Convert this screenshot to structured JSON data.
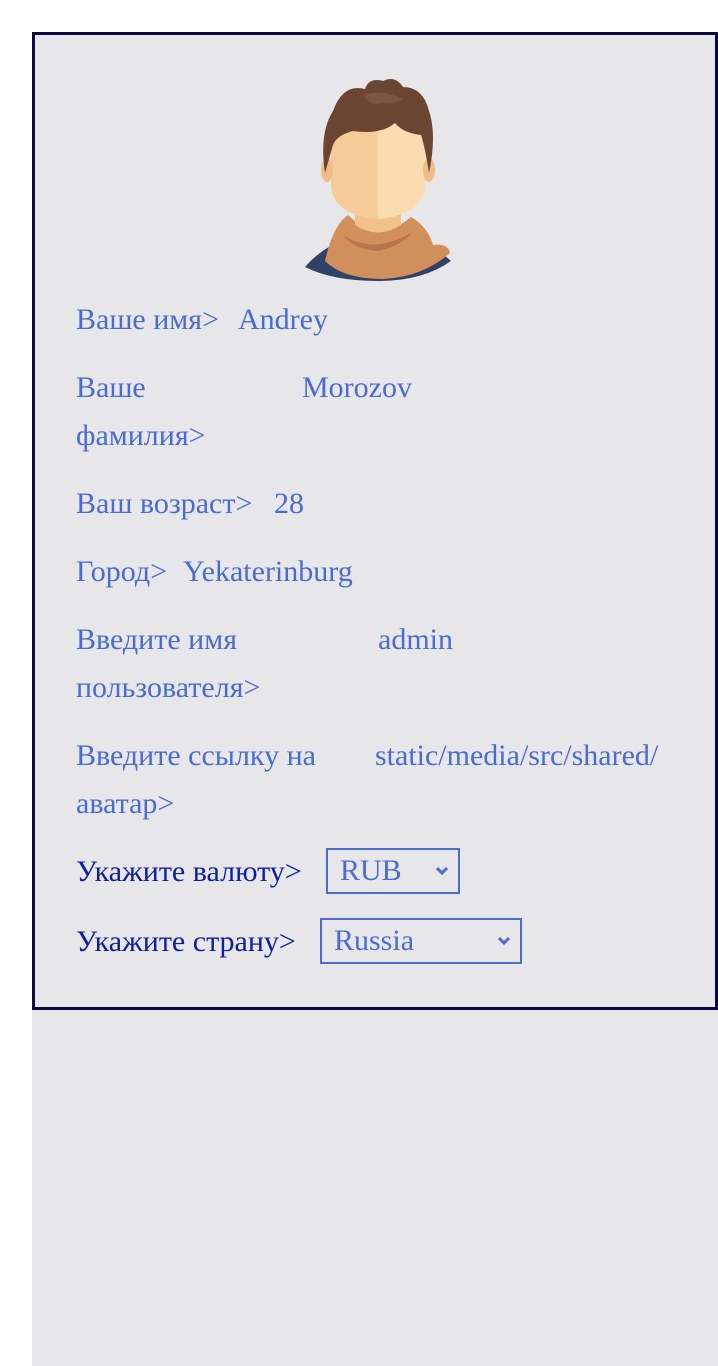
{
  "profile": {
    "first_name": {
      "label": "Ваше имя>",
      "value": "Andrey"
    },
    "last_name": {
      "label_line1": "Ваше",
      "label_line2": "фамилия>",
      "value": "Morozov"
    },
    "age": {
      "label": "Ваш возраст>",
      "value": "28"
    },
    "city": {
      "label": "Город>",
      "value": "Yekaterinburg"
    },
    "username": {
      "label_line1": "Введите имя",
      "label_line2": "пользователя>",
      "value": "admin"
    },
    "avatar_link": {
      "label_line1": "Введите ссылку на",
      "label_line2": "аватар>",
      "value": "static/media/src/shared/"
    },
    "currency": {
      "label": "Укажите валюту>",
      "selected": "RUB"
    },
    "country": {
      "label": "Укажите страну>",
      "selected": "Russia"
    }
  },
  "colors": {
    "text": "#4a6bd1",
    "label_dark": "#0b1fa0",
    "border": "#0d0940",
    "background": "#e7e6e9"
  }
}
